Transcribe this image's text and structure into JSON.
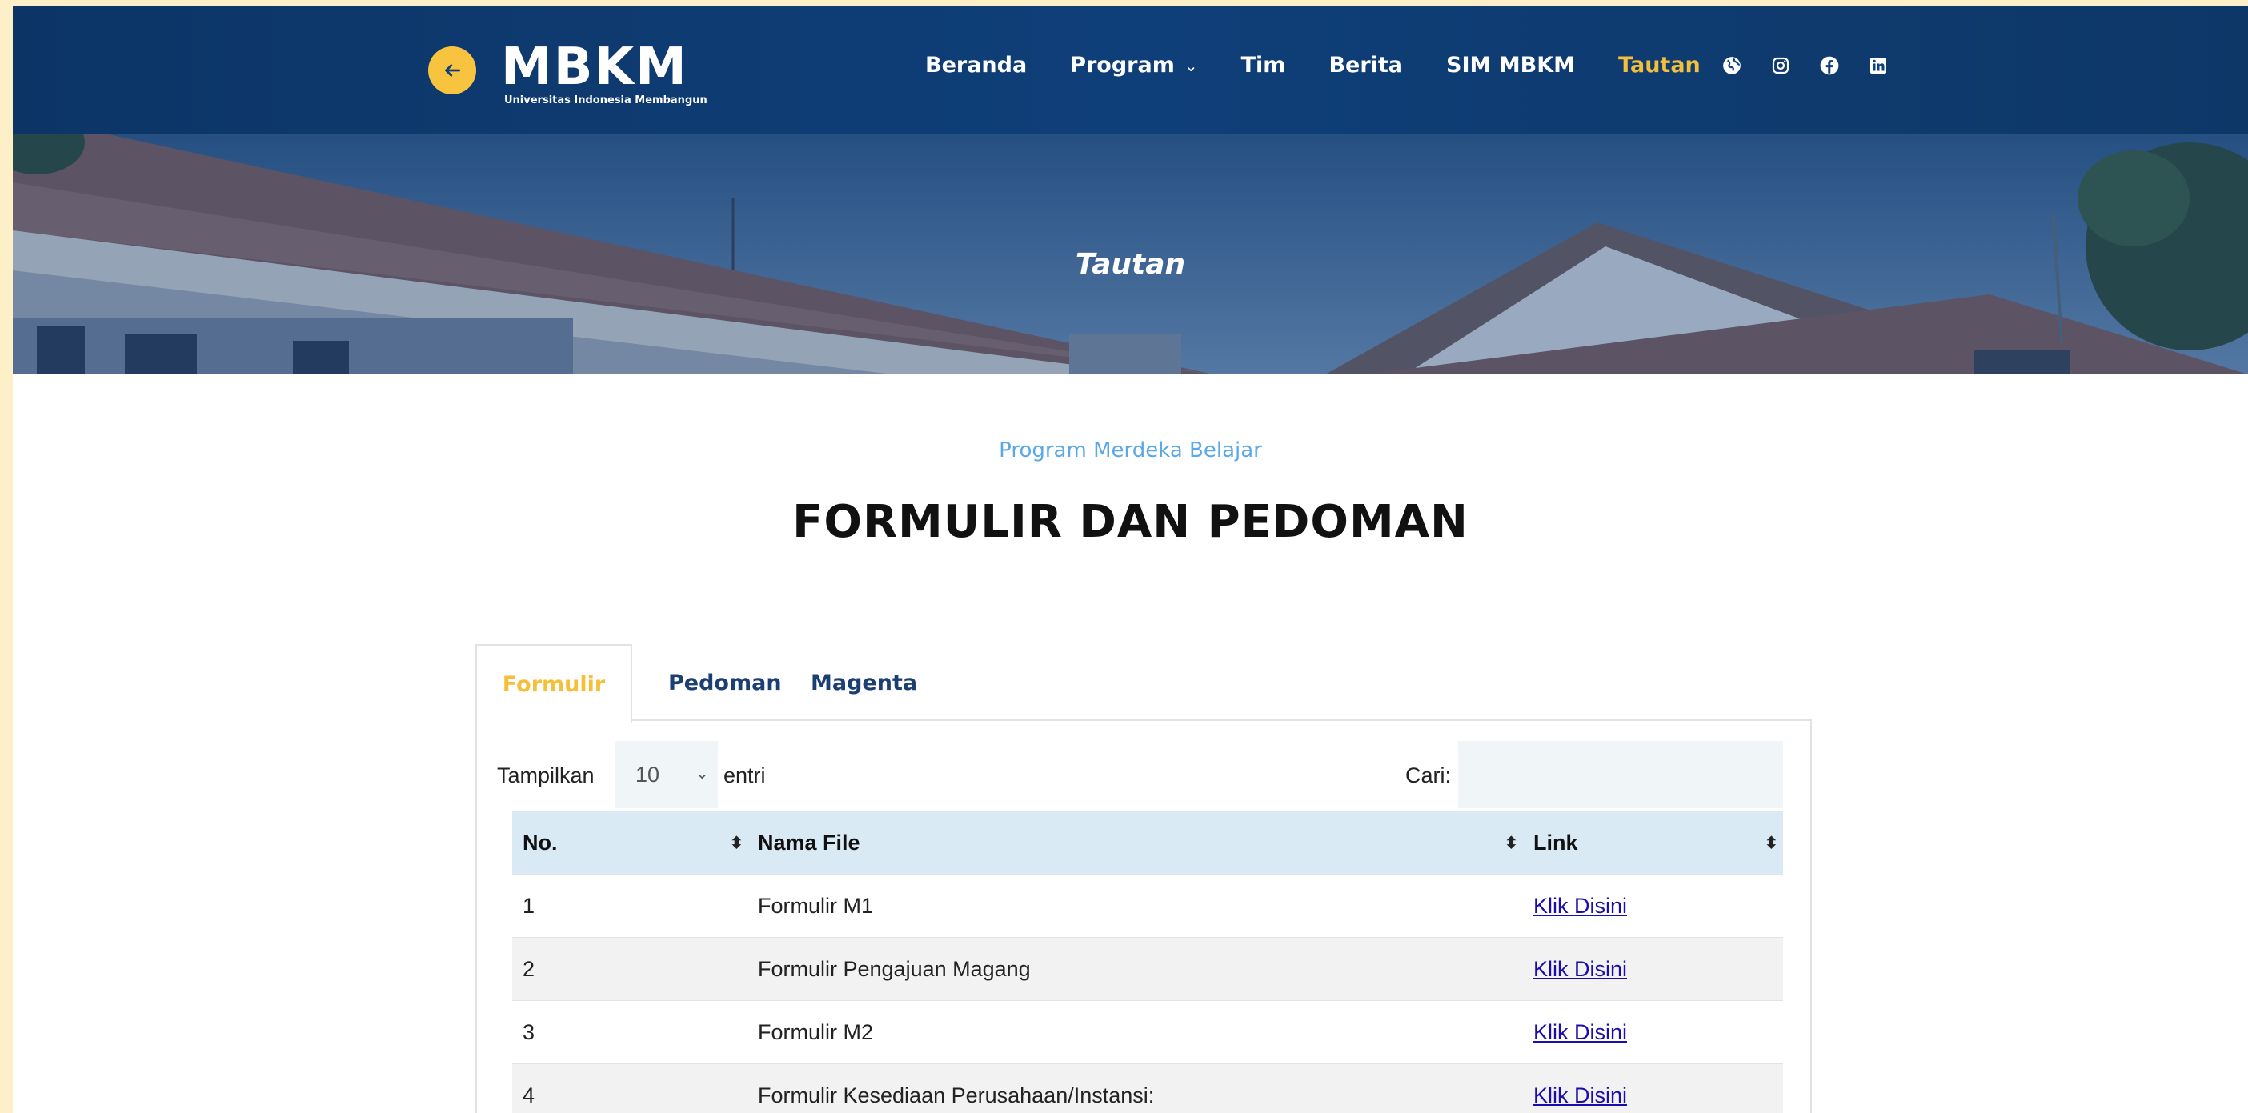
{
  "header": {
    "logo_text": "MBKM",
    "logo_subtitle": "Universitas Indonesia Membangun",
    "nav": [
      {
        "label": "Beranda"
      },
      {
        "label": "Program"
      },
      {
        "label": "Tim"
      },
      {
        "label": "Berita"
      },
      {
        "label": "SIM MBKM"
      },
      {
        "label": "Tautan",
        "active": true
      }
    ],
    "social_icons": [
      "globe-icon",
      "instagram-icon",
      "facebook-icon",
      "linkedin-icon"
    ]
  },
  "hero": {
    "title": "Tautan"
  },
  "section": {
    "eyebrow": "Program Merdeka Belajar",
    "title": "FORMULIR DAN PEDOMAN"
  },
  "tabs": [
    {
      "label": "Formulir",
      "active": true
    },
    {
      "label": "Pedoman"
    },
    {
      "label": "Magenta"
    }
  ],
  "table_controls": {
    "length_label_before": "Tampilkan",
    "length_value": "10",
    "length_label_after": "entri",
    "search_label": "Cari:",
    "search_value": ""
  },
  "table": {
    "columns": [
      "No.",
      "Nama File",
      "Link"
    ],
    "rows": [
      {
        "no": "1",
        "name": "Formulir M1",
        "link": "Klik Disini"
      },
      {
        "no": "2",
        "name": "Formulir Pengajuan Magang",
        "link": "Klik Disini"
      },
      {
        "no": "3",
        "name": "Formulir M2",
        "link": "Klik Disini"
      },
      {
        "no": "4",
        "name": "Formulir Kesediaan Perusahaan/Instansi:",
        "link": "Klik Disini"
      }
    ]
  },
  "colors": {
    "header_bg": "#0f3f79",
    "accent": "#f6bf3a",
    "table_head_bg": "#d9eaf5",
    "link": "#1a0dab"
  }
}
